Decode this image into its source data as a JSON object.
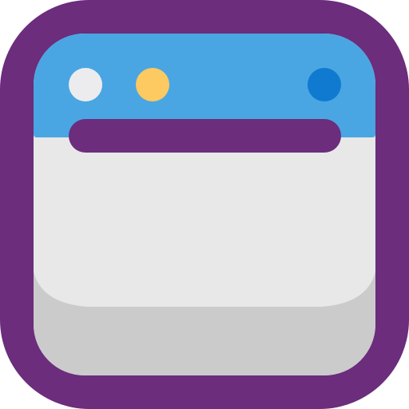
{
  "icon": {
    "name": "browser-window-icon",
    "colors": {
      "frame": "#6b2d7c",
      "titlebar": "#49a6e3",
      "content": "#e8e8e8",
      "content_bottom": "#cbcbcb",
      "dot_left": "#ececef",
      "dot_middle": "#fdc961",
      "dot_right": "#0f7ad0",
      "address_bar": "#6b2d7c"
    }
  }
}
